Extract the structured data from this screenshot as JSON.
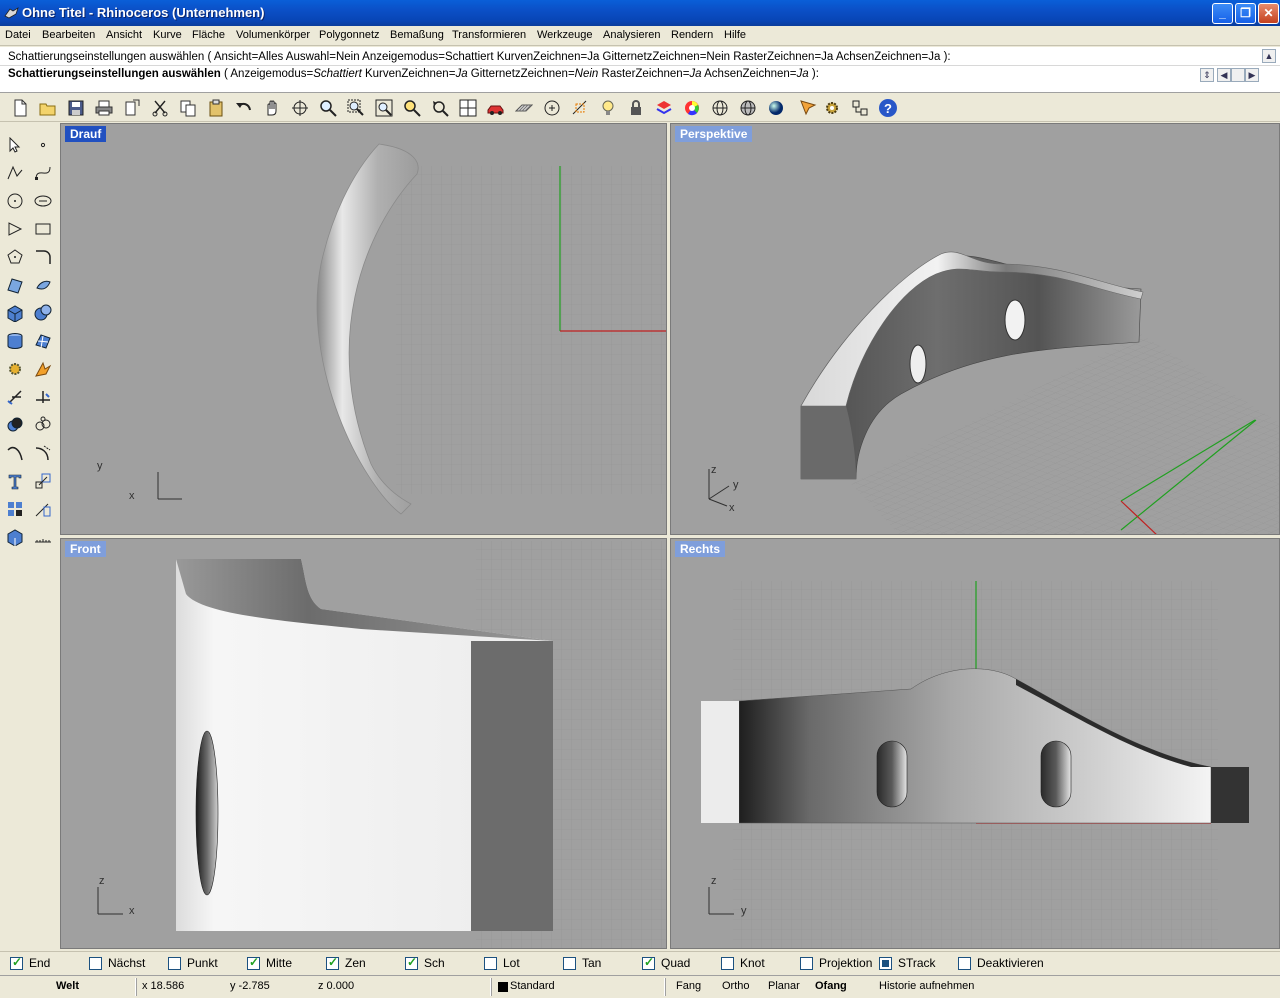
{
  "window": {
    "title": "Ohne Titel - Rhinoceros (Unternehmen)",
    "buttons": [
      "_",
      "❐",
      "✕"
    ]
  },
  "menu": [
    "Datei",
    "Bearbeiten",
    "Ansicht",
    "Kurve",
    "Fläche",
    "Volumenkörper",
    "Polygonnetz",
    "Bemaßung",
    "Transformieren",
    "Werkzeuge",
    "Analysieren",
    "Rendern",
    "Hilfe"
  ],
  "command": {
    "history": "Schattierungseinstellungen auswählen ( Ansicht=Alles  Auswahl=Nein  Anzeigemodus=Schattiert  KurvenZeichnen=Ja  GitternetzZeichnen=Nein  RasterZeichnen=Ja  AchsenZeichnen=Ja ):",
    "prompt_lead": "Schattierungseinstellungen auswählen",
    "prompt_open": " ( ",
    "opt1_name": "Anzeigemodus=",
    "opt1_val": "Schattiert",
    "opt2_name": "  KurvenZeichnen=",
    "opt2_val": "Ja",
    "opt3_name": "  GitternetzZeichnen=",
    "opt3_val": "Nein",
    "opt4_name": "  RasterZeichnen=",
    "opt4_val": "Ja",
    "opt5_name": "  AchsenZeichnen=",
    "opt5_val": "Ja",
    "prompt_close": " ):"
  },
  "viewports": {
    "top": {
      "label": "Drauf",
      "axis1": "y",
      "axis2": "x"
    },
    "perspective": {
      "label": "Perspektive",
      "axis1": "z",
      "axis2": "y",
      "axis3": "x"
    },
    "front": {
      "label": "Front",
      "axis1": "z",
      "axis2": "x"
    },
    "right": {
      "label": "Rechts",
      "axis1": "z",
      "axis2": "y"
    }
  },
  "osnap": [
    {
      "label": "End",
      "checked": true
    },
    {
      "label": "Nächst",
      "checked": false
    },
    {
      "label": "Punkt",
      "checked": false
    },
    {
      "label": "Mitte",
      "checked": true
    },
    {
      "label": "Zen",
      "checked": true
    },
    {
      "label": "Sch",
      "checked": true
    },
    {
      "label": "Lot",
      "checked": false
    },
    {
      "label": "Tan",
      "checked": false
    },
    {
      "label": "Quad",
      "checked": true
    },
    {
      "label": "Knot",
      "checked": false
    },
    {
      "label": "Projektion",
      "checked": false
    },
    {
      "label": "STrack",
      "checked": true
    },
    {
      "label": "Deaktivieren",
      "checked": false
    }
  ],
  "status": {
    "cplane": "Welt",
    "x": "x 18.586",
    "y": "y -2.785",
    "z": "z 0.000",
    "layer": "Standard",
    "fang": "Fang",
    "ortho": "Ortho",
    "planar": "Planar",
    "ofang": "Ofang",
    "history": "Historie aufnehmen"
  },
  "colors": {
    "titlebar": "#0b4fc6",
    "viewport_bg": "#a0a0a0",
    "active_label": "#2150c0",
    "inactive_label": "#7f9edb",
    "grid_minor": "#949494",
    "axis_x": "#c02020",
    "axis_y": "#20a020"
  }
}
